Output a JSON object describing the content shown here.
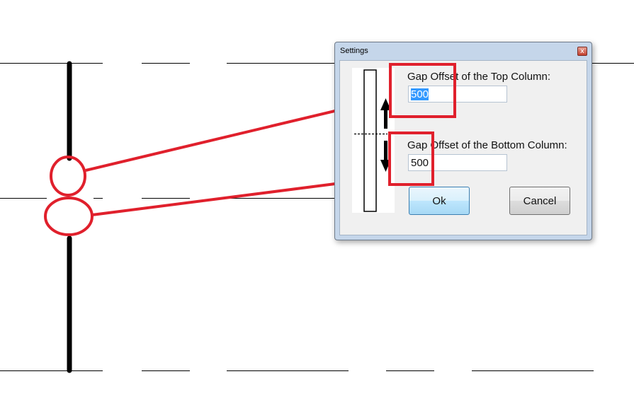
{
  "dialog": {
    "title": "Settings",
    "close_glyph": "x",
    "top_label": "Gap Offset of the Top Column:",
    "top_value": "500",
    "bottom_label": "Gap Offset of the Bottom Column:",
    "bottom_value": "500",
    "ok_label": "Ok",
    "cancel_label": "Cancel"
  },
  "colors": {
    "highlight": "#e0202c",
    "column_line": "#000000",
    "selection": "#3399ff"
  },
  "icons": [
    "close-icon",
    "up-arrow-icon",
    "down-arrow-icon"
  ]
}
